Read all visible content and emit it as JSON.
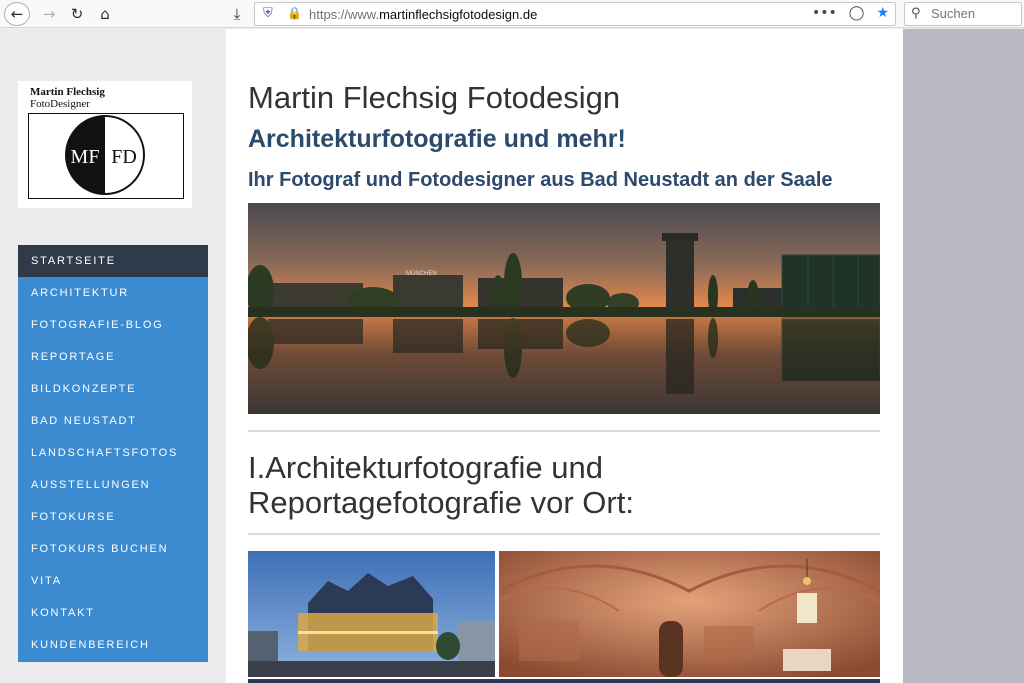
{
  "browser": {
    "url_prefix": "https://www.",
    "url_domain": "martinflechsigfotodesign.de",
    "search_placeholder": "Suchen",
    "icons": [
      "back-icon",
      "forward-icon",
      "reload-icon",
      "home-icon",
      "library-icon",
      "shield-icon",
      "lock-icon",
      "more-icon",
      "pocket-icon",
      "bookmark-star-icon",
      "search-icon"
    ]
  },
  "logo": {
    "name": "Martin Flechsig",
    "sub": "FotoDesigner",
    "monogram_left": "MF",
    "monogram_right": "FD"
  },
  "nav": {
    "items": [
      {
        "label": "STARTSEITE",
        "active": true
      },
      {
        "label": "ARCHITEKTUR"
      },
      {
        "label": "FOTOGRAFIE-BLOG"
      },
      {
        "label": "REPORTAGE"
      },
      {
        "label": "BILDKONZEPTE"
      },
      {
        "label": "BAD NEUSTADT"
      },
      {
        "label": "LANDSCHAFTSFOTOS"
      },
      {
        "label": "AUSSTELLUNGEN"
      },
      {
        "label": "FOTOKURSE"
      },
      {
        "label": "FOTOKURS BUCHEN"
      },
      {
        "label": "VITA"
      },
      {
        "label": "KONTAKT"
      },
      {
        "label": "KUNDENBEREICH"
      }
    ],
    "color": "#3c8bd0",
    "active_color": "#2f3b4a"
  },
  "main": {
    "title": "Martin Flechsig Fotodesign",
    "subtitle": "Architekturfotografie und mehr!",
    "tagline": "Ihr Fotograf und Fotodesigner aus Bad Neustadt an der Saale",
    "hero_sign": "MÜNCHEN",
    "section_title_line1": "I.Architekturfotografie und",
    "section_title_line2": "Reportagefotografie vor Ort:"
  }
}
